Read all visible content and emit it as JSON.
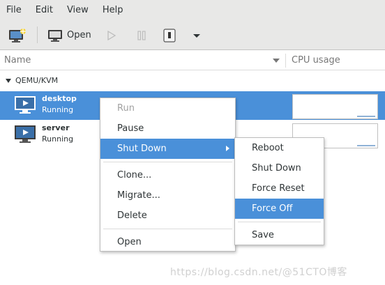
{
  "menubar": {
    "items": [
      "File",
      "Edit",
      "View",
      "Help"
    ]
  },
  "toolbar": {
    "open_label": "Open"
  },
  "columns": {
    "name": "Name",
    "cpu": "CPU usage"
  },
  "connection": {
    "label": "QEMU/KVM"
  },
  "vms": [
    {
      "name": "desktop",
      "state": "Running"
    },
    {
      "name": "server",
      "state": "Running"
    }
  ],
  "context_menu": {
    "items": [
      "Run",
      "Pause",
      "Shut Down",
      "Clone...",
      "Migrate...",
      "Delete",
      "Open"
    ]
  },
  "shutdown_submenu": {
    "items": [
      "Reboot",
      "Shut Down",
      "Force Reset",
      "Force Off",
      "Save"
    ]
  },
  "colors": {
    "selection": "#4a90d9",
    "background": "#e8e8e7"
  },
  "watermark": "https://blog.csdn.net/@51CTO博客"
}
